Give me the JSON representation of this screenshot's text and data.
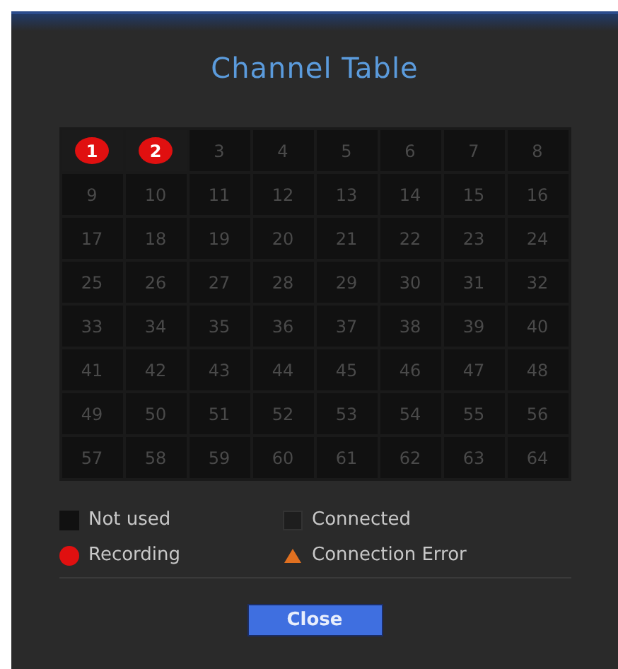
{
  "window": {
    "title": "Channel Table"
  },
  "channels": [
    {
      "number": "1",
      "kind": "recording"
    },
    {
      "number": "2",
      "kind": "recording"
    },
    {
      "number": "3",
      "kind": "not_used"
    },
    {
      "number": "4",
      "kind": "not_used"
    },
    {
      "number": "5",
      "kind": "not_used"
    },
    {
      "number": "6",
      "kind": "not_used"
    },
    {
      "number": "7",
      "kind": "not_used"
    },
    {
      "number": "8",
      "kind": "not_used"
    },
    {
      "number": "9",
      "kind": "not_used"
    },
    {
      "number": "10",
      "kind": "not_used"
    },
    {
      "number": "11",
      "kind": "not_used"
    },
    {
      "number": "12",
      "kind": "not_used"
    },
    {
      "number": "13",
      "kind": "not_used"
    },
    {
      "number": "14",
      "kind": "not_used"
    },
    {
      "number": "15",
      "kind": "not_used"
    },
    {
      "number": "16",
      "kind": "not_used"
    },
    {
      "number": "17",
      "kind": "not_used"
    },
    {
      "number": "18",
      "kind": "not_used"
    },
    {
      "number": "19",
      "kind": "not_used"
    },
    {
      "number": "20",
      "kind": "not_used"
    },
    {
      "number": "21",
      "kind": "not_used"
    },
    {
      "number": "22",
      "kind": "not_used"
    },
    {
      "number": "23",
      "kind": "not_used"
    },
    {
      "number": "24",
      "kind": "not_used"
    },
    {
      "number": "25",
      "kind": "not_used"
    },
    {
      "number": "26",
      "kind": "not_used"
    },
    {
      "number": "27",
      "kind": "not_used"
    },
    {
      "number": "28",
      "kind": "not_used"
    },
    {
      "number": "29",
      "kind": "not_used"
    },
    {
      "number": "30",
      "kind": "not_used"
    },
    {
      "number": "31",
      "kind": "not_used"
    },
    {
      "number": "32",
      "kind": "not_used"
    },
    {
      "number": "33",
      "kind": "not_used"
    },
    {
      "number": "34",
      "kind": "not_used"
    },
    {
      "number": "35",
      "kind": "not_used"
    },
    {
      "number": "36",
      "kind": "not_used"
    },
    {
      "number": "37",
      "kind": "not_used"
    },
    {
      "number": "38",
      "kind": "not_used"
    },
    {
      "number": "39",
      "kind": "not_used"
    },
    {
      "number": "40",
      "kind": "not_used"
    },
    {
      "number": "41",
      "kind": "not_used"
    },
    {
      "number": "42",
      "kind": "not_used"
    },
    {
      "number": "43",
      "kind": "not_used"
    },
    {
      "number": "44",
      "kind": "not_used"
    },
    {
      "number": "45",
      "kind": "not_used"
    },
    {
      "number": "46",
      "kind": "not_used"
    },
    {
      "number": "47",
      "kind": "not_used"
    },
    {
      "number": "48",
      "kind": "not_used"
    },
    {
      "number": "49",
      "kind": "not_used"
    },
    {
      "number": "50",
      "kind": "not_used"
    },
    {
      "number": "51",
      "kind": "not_used"
    },
    {
      "number": "52",
      "kind": "not_used"
    },
    {
      "number": "53",
      "kind": "not_used"
    },
    {
      "number": "54",
      "kind": "not_used"
    },
    {
      "number": "55",
      "kind": "not_used"
    },
    {
      "number": "56",
      "kind": "not_used"
    },
    {
      "number": "57",
      "kind": "not_used"
    },
    {
      "number": "58",
      "kind": "not_used"
    },
    {
      "number": "59",
      "kind": "not_used"
    },
    {
      "number": "60",
      "kind": "not_used"
    },
    {
      "number": "61",
      "kind": "not_used"
    },
    {
      "number": "62",
      "kind": "not_used"
    },
    {
      "number": "63",
      "kind": "not_used"
    },
    {
      "number": "64",
      "kind": "not_used"
    }
  ],
  "legend": [
    {
      "kind": "not_used",
      "label": "Not used"
    },
    {
      "kind": "connected",
      "label": "Connected"
    },
    {
      "kind": "recording",
      "label": "Recording"
    },
    {
      "kind": "connection_error",
      "label": "Connection Error"
    }
  ],
  "buttons": [
    "Close"
  ]
}
